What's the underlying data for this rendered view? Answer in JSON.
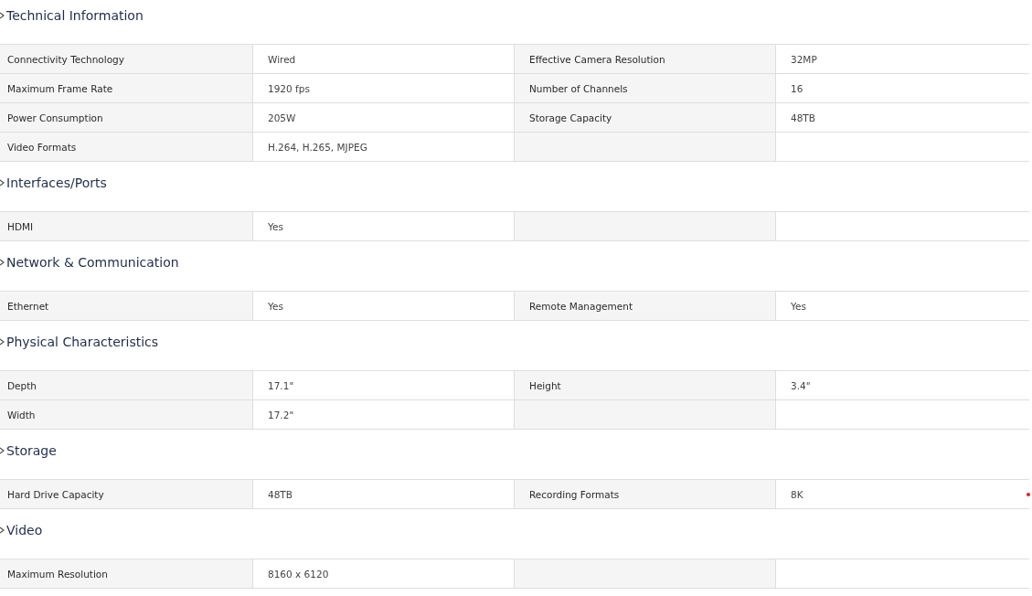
{
  "sections": [
    {
      "title": "Technical Information",
      "rows": [
        [
          "Connectivity Technology",
          "Wired",
          "Effective Camera Resolution",
          "32MP"
        ],
        [
          "Maximum Frame Rate",
          "1920 fps",
          "Number of Channels",
          "16"
        ],
        [
          "Power Consumption",
          "205W",
          "Storage Capacity",
          "48TB"
        ],
        [
          "Video Formats",
          "H.264, H.265, MJPEG"
        ]
      ]
    },
    {
      "title": "Interfaces/Ports",
      "rows": [
        [
          "HDMI",
          "Yes"
        ]
      ]
    },
    {
      "title": "Network & Communication",
      "rows": [
        [
          "Ethernet",
          "Yes",
          "Remote Management",
          "Yes"
        ]
      ]
    },
    {
      "title": "Physical Characteristics",
      "rows": [
        [
          "Depth",
          "17.1\"",
          "Height",
          "3.4\""
        ],
        [
          "Width",
          "17.2\""
        ]
      ]
    },
    {
      "title": "Storage",
      "rows": [
        [
          "Hard Drive Capacity",
          "48TB",
          "Recording Formats",
          "8K"
        ]
      ]
    },
    {
      "title": "Video",
      "rows": [
        [
          "Maximum Resolution",
          "8160 x 6120"
        ]
      ]
    }
  ]
}
